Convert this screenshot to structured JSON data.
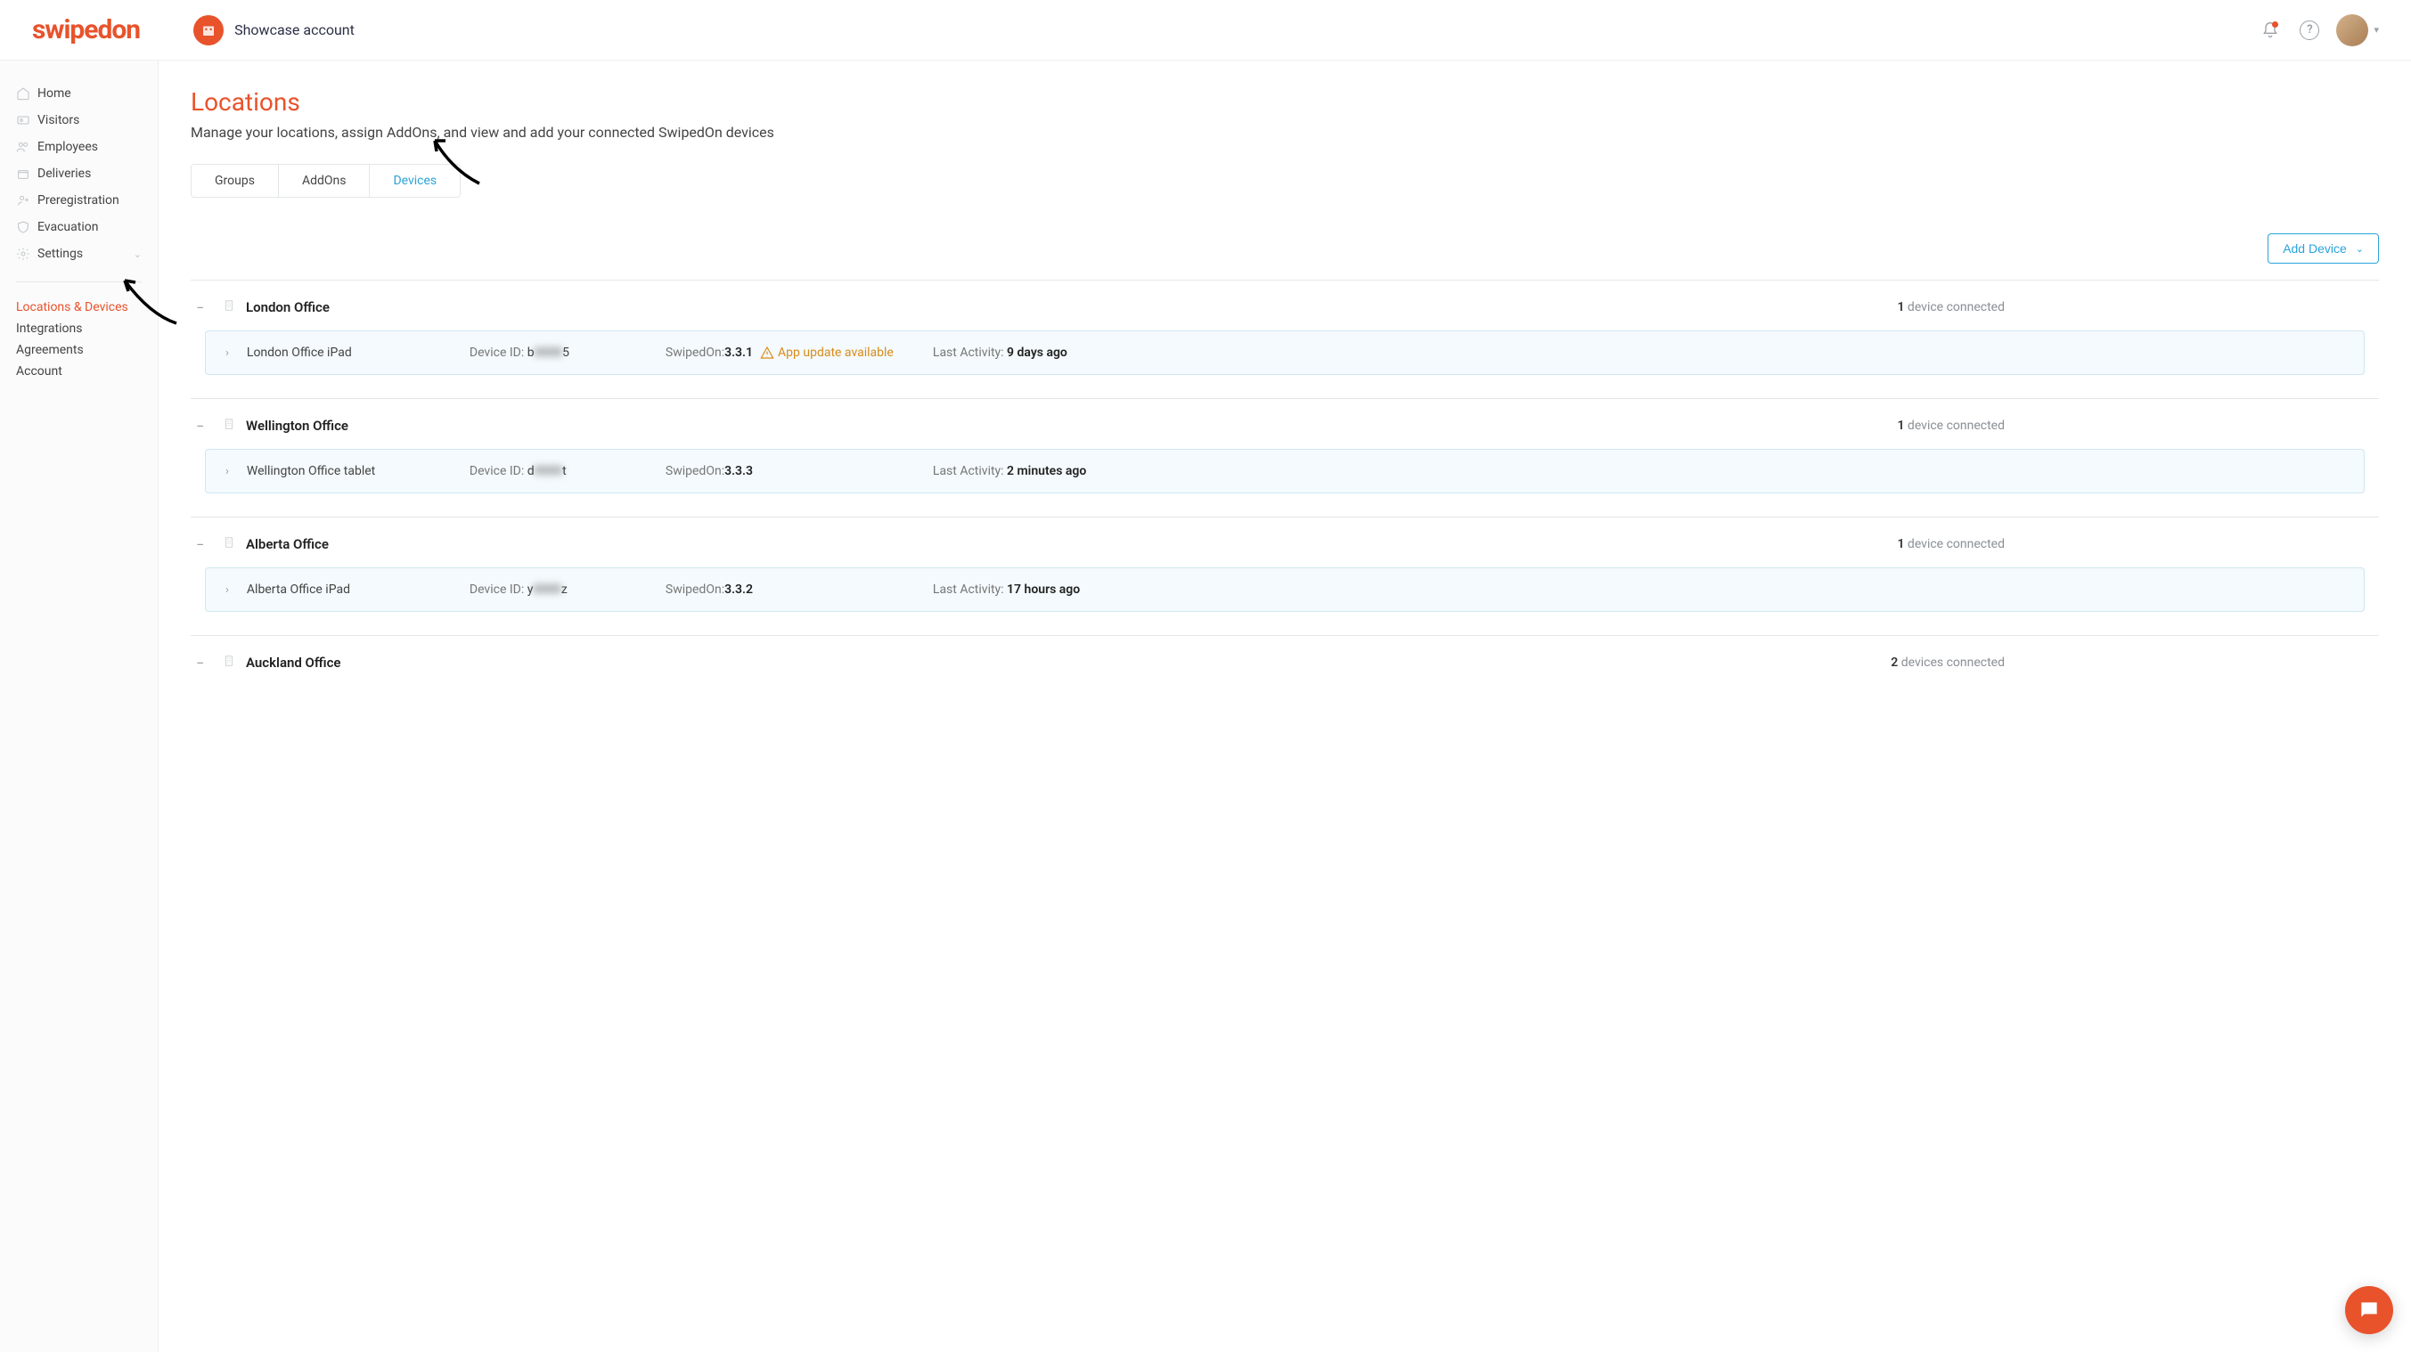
{
  "brand": "swipedon",
  "account_name": "Showcase account",
  "sidebar": {
    "main": [
      {
        "label": "Home"
      },
      {
        "label": "Visitors"
      },
      {
        "label": "Employees"
      },
      {
        "label": "Deliveries"
      },
      {
        "label": "Preregistration"
      },
      {
        "label": "Evacuation"
      },
      {
        "label": "Settings"
      }
    ],
    "secondary": [
      {
        "label": "Locations & Devices",
        "active": true
      },
      {
        "label": "Integrations"
      },
      {
        "label": "Agreements"
      },
      {
        "label": "Account"
      }
    ]
  },
  "page": {
    "title": "Locations",
    "subtitle": "Manage your locations, assign AddOns, and view and add your connected SwipedOn devices"
  },
  "tabs": [
    {
      "label": "Groups"
    },
    {
      "label": "AddOns"
    },
    {
      "label": "Devices",
      "active": true
    }
  ],
  "add_button": "Add Device",
  "field_labels": {
    "device_id": "Device ID: ",
    "swipedon": "SwipedOn: ",
    "last_activity": "Last Activity: "
  },
  "status_suffix_singular": " device connected",
  "status_suffix_plural": " devices connected",
  "locations": [
    {
      "name": "London Office",
      "device_count": "1",
      "devices": [
        {
          "name": "London Office iPad",
          "device_id_prefix": "b",
          "device_id_blur": "0000",
          "device_id_suffix": "5",
          "version": "3.3.1",
          "update_warning": "App update available",
          "last_activity": "9 days ago"
        }
      ]
    },
    {
      "name": "Wellington Office",
      "device_count": "1",
      "devices": [
        {
          "name": "Wellington Office tablet",
          "device_id_prefix": "d",
          "device_id_blur": "0000",
          "device_id_suffix": "t",
          "version": "3.3.3",
          "last_activity": "2 minutes ago"
        }
      ]
    },
    {
      "name": "Alberta Office",
      "device_count": "1",
      "devices": [
        {
          "name": "Alberta Office iPad",
          "device_id_prefix": "y",
          "device_id_blur": "0000",
          "device_id_suffix": "z",
          "version": "3.3.2",
          "last_activity": "17 hours ago"
        }
      ]
    },
    {
      "name": "Auckland Office",
      "device_count": "2",
      "devices": []
    }
  ]
}
